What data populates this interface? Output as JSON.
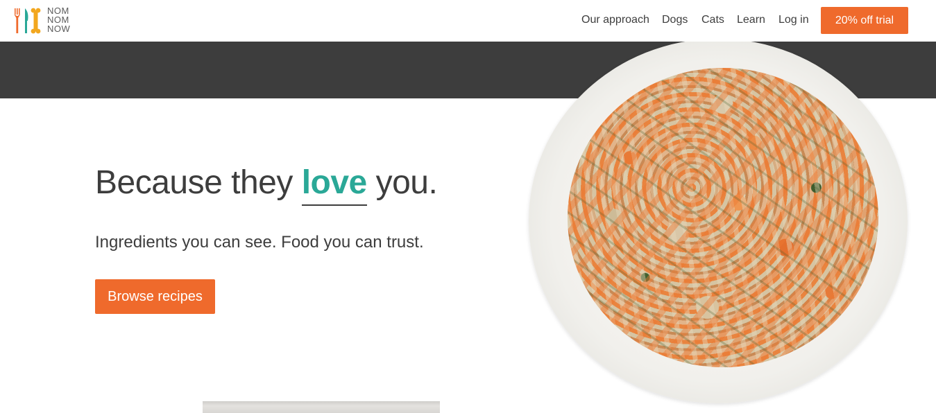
{
  "brand": {
    "lines": [
      "NOM",
      "NOM",
      "NOW"
    ],
    "logo_colors": [
      "#ef6a2c",
      "#2aa897",
      "#f2a71f"
    ]
  },
  "nav": {
    "items": [
      {
        "label": "Our approach"
      },
      {
        "label": "Dogs"
      },
      {
        "label": "Cats"
      },
      {
        "label": "Learn"
      },
      {
        "label": "Log in"
      }
    ],
    "cta_label": "20% off trial"
  },
  "hero": {
    "headline_before": "Because they ",
    "headline_highlight": "love",
    "headline_after": " you.",
    "subheadline": "Ingredients you can see. Food you can trust.",
    "button_label": "Browse recipes"
  },
  "colors": {
    "accent_orange": "#ef6a2c",
    "accent_teal": "#2aa897",
    "band_dark": "#3d3d3d"
  },
  "icons": {
    "logo": "fork-knife-bone-logo-icon"
  }
}
